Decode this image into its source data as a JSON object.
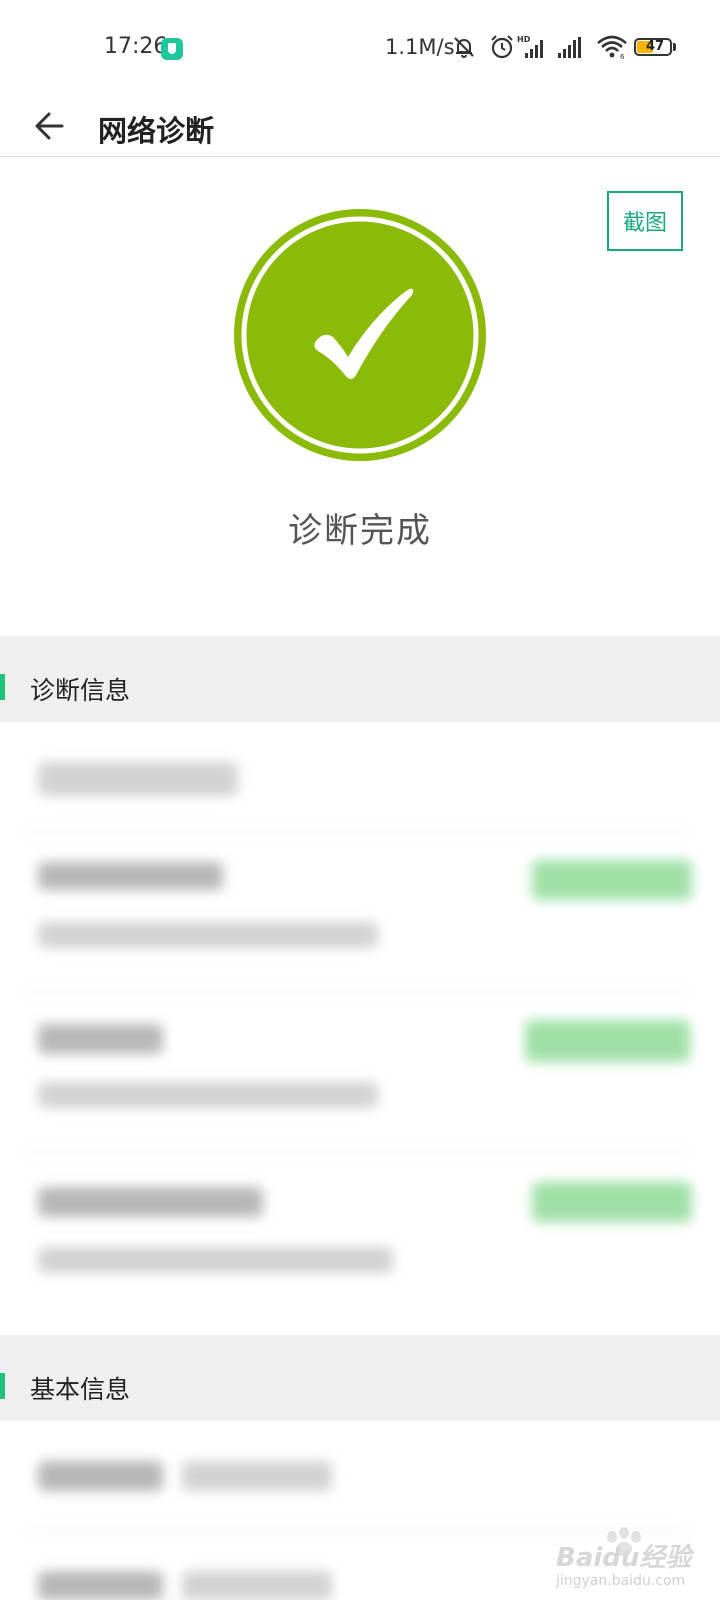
{
  "status_bar": {
    "time": "17:26",
    "net_speed": "1.1M/s",
    "battery_level": "47",
    "icons": [
      "shield-icon",
      "bell-muted-icon",
      "alarm-icon",
      "hd-signal-icon",
      "signal-icon",
      "wifi-icon",
      "battery-icon"
    ]
  },
  "header": {
    "title": "网络诊断",
    "back_icon": "arrow-left-icon"
  },
  "result": {
    "screenshot_label": "截图",
    "status_text": "诊断完成",
    "status_icon": "check-circle-icon",
    "color": "#8cba09"
  },
  "sections": {
    "diagnosis_title": "诊断信息",
    "basic_title": "基本信息"
  },
  "watermark": {
    "text": "Baidu经验",
    "sub": "jingyan.baidu.com"
  },
  "colors": {
    "accent": "#1aa881",
    "section_bar": "#1ec27a",
    "success": "#8cba09",
    "section_bg": "#efefef"
  }
}
